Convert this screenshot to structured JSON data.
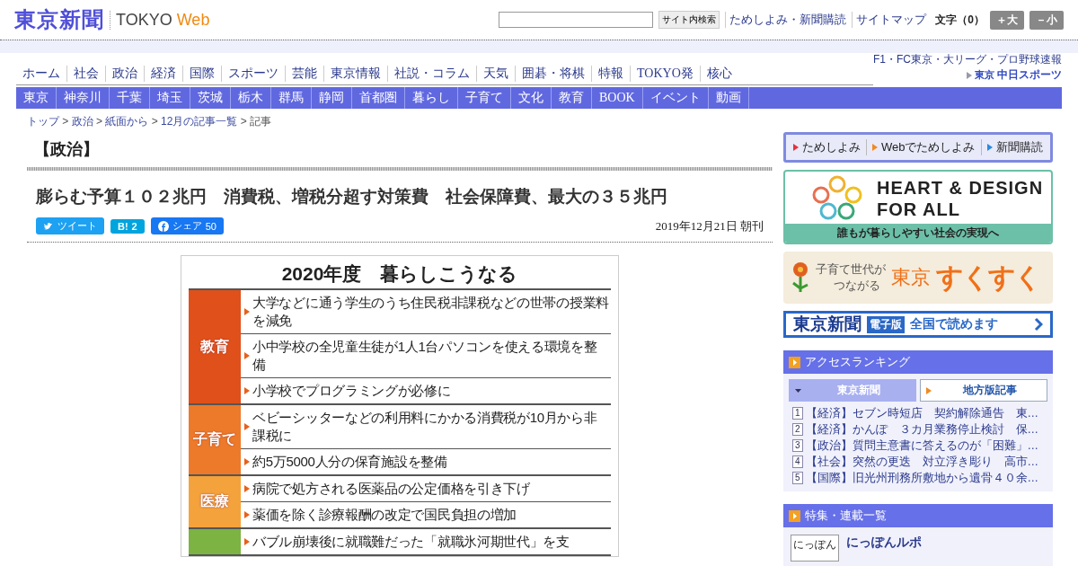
{
  "header": {
    "logo": "東京新聞",
    "brand": "TOKYO",
    "brand_accent": "Web",
    "search": {
      "button": "サイト内検索"
    },
    "links": [
      "ためしよみ・新聞購読",
      "サイトマップ"
    ],
    "font_size": {
      "label": "文字（0）",
      "buttons": [
        "＋大",
        "－小"
      ]
    }
  },
  "nav": {
    "main": [
      "ホーム",
      "社会",
      "政治",
      "経済",
      "国際",
      "スポーツ",
      "芸能",
      "東京情報",
      "社説・コラム",
      "天気",
      "囲碁・将棋",
      "特報",
      "TOKYO発",
      "核心"
    ],
    "sub": [
      "東京",
      "神奈川",
      "千葉",
      "埼玉",
      "茨城",
      "栃木",
      "群馬",
      "静岡",
      "首都圏",
      "暮らし",
      "子育て",
      "文化",
      "教育",
      "BOOK",
      "イベント",
      "動画"
    ],
    "sports": {
      "caption": "F1・FC東京・大リーグ・プロ野球速報",
      "prefix": "東京",
      "name": "中日スポーツ"
    }
  },
  "breadcrumb": {
    "separator": ">",
    "items": [
      "トップ",
      "政治",
      "紙面から",
      "12月の記事一覧",
      "記事"
    ]
  },
  "article": {
    "category": "【政治】",
    "headline": "膨らむ予算１０２兆円　消費税、増税分超す対策費　社会保障費、最大の３５兆円",
    "share": [
      {
        "kind": "twitter",
        "label": "ツイート"
      },
      {
        "kind": "hatena",
        "label": "B!",
        "count": "2"
      },
      {
        "kind": "facebook",
        "label": "シェア",
        "count": "50"
      }
    ],
    "date": "2019年12月21日 朝刊",
    "figure": {
      "title": "2020年度　暮らしこうなる",
      "groups": [
        {
          "label": "教育",
          "color": "#e0501a",
          "items": [
            "大学などに通う学生のうち住民税非課税などの世帯の授業料を減免",
            "小中学校の全児童生徒が1人1台パソコンを使える環境を整備",
            "小学校でプログラミングが必修に"
          ]
        },
        {
          "label": "子育て",
          "color": "#ec7a2a",
          "items": [
            "ベビーシッターなどの利用料にかかる消費税が10月から非課税に",
            "約5万5000人分の保育施設を整備"
          ]
        },
        {
          "label": "医療",
          "color": "#f4a23c",
          "items": [
            "病院で処方される医薬品の公定価格を引き下げ",
            "薬価を除く診療報酬の改定で国民負担の増加"
          ]
        },
        {
          "color": "#7cb342",
          "items": [
            "バブル崩壊後に就職難だった「就職氷河期世代」を支"
          ]
        }
      ]
    }
  },
  "sidebar": {
    "trial": [
      {
        "label": "ためしよみ",
        "color": "#e8303a"
      },
      {
        "label": "Webでためしよみ",
        "color": "#f08a20"
      },
      {
        "label": "新聞購読",
        "color": "#2a8ae0"
      }
    ],
    "heart": {
      "line1": "HEART & DESIGN",
      "line2": "FOR ALL",
      "caption": "誰もが暮らしやすい社会の実現へ"
    },
    "sukusuku": {
      "line1": "子育て世代が",
      "line2": "つながる",
      "city": "東京",
      "name": "すくすく"
    },
    "digital": {
      "name": "東京新聞",
      "badge": "電子版",
      "text": "全国で読めます"
    },
    "ranking": {
      "title": "アクセスランキング",
      "tabs": [
        {
          "label": "東京新聞",
          "selected": true
        },
        {
          "label": "地方版記事",
          "selected": false
        }
      ],
      "items": [
        {
          "rank": "1",
          "text": "【経済】セブン時短店　契約解除通告　東…"
        },
        {
          "rank": "2",
          "text": "【経済】かんぽ　３カ月業務停止検討　保…"
        },
        {
          "rank": "3",
          "text": "【政治】質問主意書に答えるのが「困難」…"
        },
        {
          "rank": "4",
          "text": "【社会】突然の更迭　対立浮き彫り　高市…"
        },
        {
          "rank": "5",
          "text": "【国際】旧光州刑務所敷地から遺骨４０余…"
        }
      ]
    },
    "features": {
      "title": "特集・連載一覧",
      "items": [
        {
          "thumb": "にっぽん",
          "title": "にっぽんルポ"
        }
      ]
    }
  }
}
